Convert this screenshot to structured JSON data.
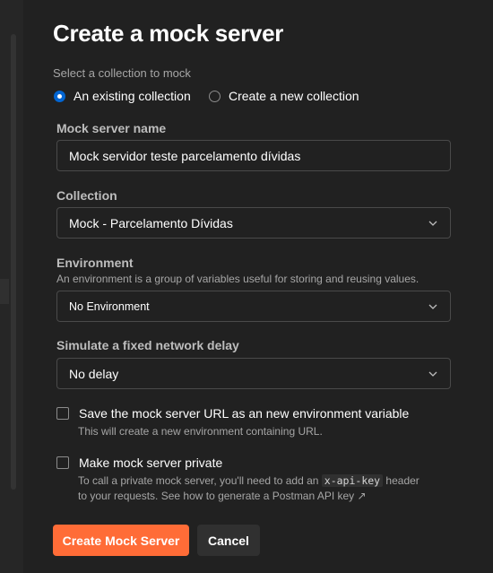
{
  "title": "Create a mock server",
  "collection_section": {
    "label": "Select a collection to mock",
    "options": [
      {
        "label": "An existing collection",
        "selected": true
      },
      {
        "label": "Create a new collection",
        "selected": false
      }
    ]
  },
  "mock_name": {
    "label": "Mock server name",
    "value": "Mock servidor teste parcelamento dívidas"
  },
  "collection": {
    "label": "Collection",
    "value": "Mock - Parcelamento Dívidas"
  },
  "environment": {
    "label": "Environment",
    "helper": "An environment is a group of variables useful for storing and reusing values.",
    "value": "No Environment"
  },
  "delay": {
    "label": "Simulate a fixed network delay",
    "value": "No delay"
  },
  "save_url": {
    "label": "Save the mock server URL as an new environment variable",
    "helper": "This will create a new environment containing URL.",
    "checked": false
  },
  "private": {
    "label": "Make mock server private",
    "helper_prefix": "To call a private mock server, you'll need to add an ",
    "helper_code": "x-api-key",
    "helper_suffix": " header",
    "helper_line2": "to your requests. See how to generate a Postman API key ↗",
    "checked": false
  },
  "buttons": {
    "create": "Create Mock Server",
    "cancel": "Cancel"
  },
  "colors": {
    "accent": "#ff6c37",
    "radio_selected": "#0265d2",
    "background": "#212121"
  }
}
